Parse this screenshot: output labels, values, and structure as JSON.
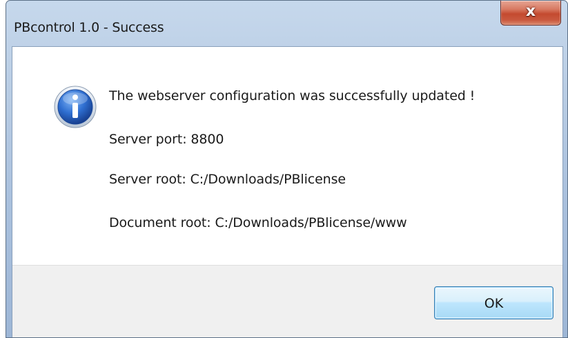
{
  "window": {
    "title": "PBcontrol 1.0 - Success",
    "close_glyph": "x"
  },
  "message": {
    "icon": "info-icon",
    "lines": [
      "The webserver configuration was successfully updated !",
      "Server port: 8800",
      "Server root: C:/Downloads/PBlicense",
      "Document root: C:/Downloads/PBlicense/www"
    ]
  },
  "buttons": {
    "ok_label": "OK"
  },
  "colors": {
    "titlebar": "#b7cbe3",
    "close_button": "#c44a2f",
    "footer": "#f0f0f0",
    "ok_border": "#3c7fb1",
    "info_icon": "#2f6fd1"
  }
}
